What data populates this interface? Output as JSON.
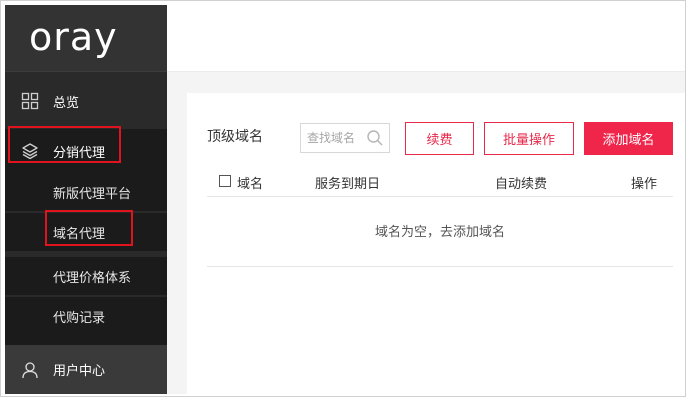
{
  "brand": {
    "logo": "oray"
  },
  "sidebar": {
    "overview": "总览",
    "agent": "分销代理",
    "sub_items": [
      "新版代理平台",
      "域名代理",
      "代理价格体系",
      "代购记录"
    ],
    "user_center": "用户中心"
  },
  "panel": {
    "title": "顶级域名",
    "search_placeholder": "查找域名",
    "buttons": {
      "renew": "续费",
      "batch": "批量操作",
      "add": "添加域名"
    },
    "columns": {
      "name": "域名",
      "expire": "服务到期日",
      "auto_renew": "自动续费",
      "operation": "操作"
    },
    "empty_message": "域名为空，去添加域名"
  },
  "colors": {
    "sidebar_bg": "#2a2a2a",
    "accent": "#f0254a",
    "highlight": "#e0141e"
  }
}
